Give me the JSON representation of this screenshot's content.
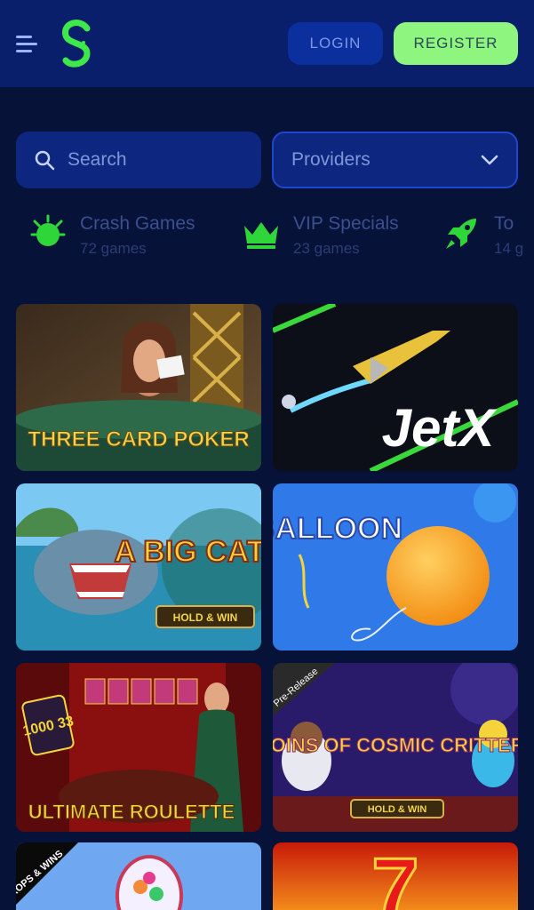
{
  "header": {
    "login_label": "LOGIN",
    "register_label": "REGISTER",
    "colors": {
      "bar": "#0a1f6b",
      "accent_green": "#8ef57f",
      "login_bg": "#0c2f9e"
    }
  },
  "search": {
    "placeholder": "Search"
  },
  "providers": {
    "label": "Providers"
  },
  "categories": [
    {
      "title": "Crash Games",
      "count": "72 games",
      "icon": "sun-burst-icon"
    },
    {
      "title": "VIP Specials",
      "count": "23 games",
      "icon": "crown-icon"
    },
    {
      "title": "To",
      "count": "14 g",
      "icon": "rocket-icon"
    }
  ],
  "games": [
    {
      "name": "THREE CARD POKER"
    },
    {
      "name": "JetX"
    },
    {
      "name": "A BIG CATCH",
      "badge": "HOLD & WIN"
    },
    {
      "name": "BALLOON"
    },
    {
      "name": "ULTIMATE ROULETTE",
      "badge": "1000 33"
    },
    {
      "name": "COINS OF COSMIC CRITTERS",
      "badge": "HOLD & WIN",
      "ribbon": "Pre-Release"
    },
    {
      "name": "",
      "badge": "DROPS & WINS"
    },
    {
      "name": "7"
    }
  ]
}
